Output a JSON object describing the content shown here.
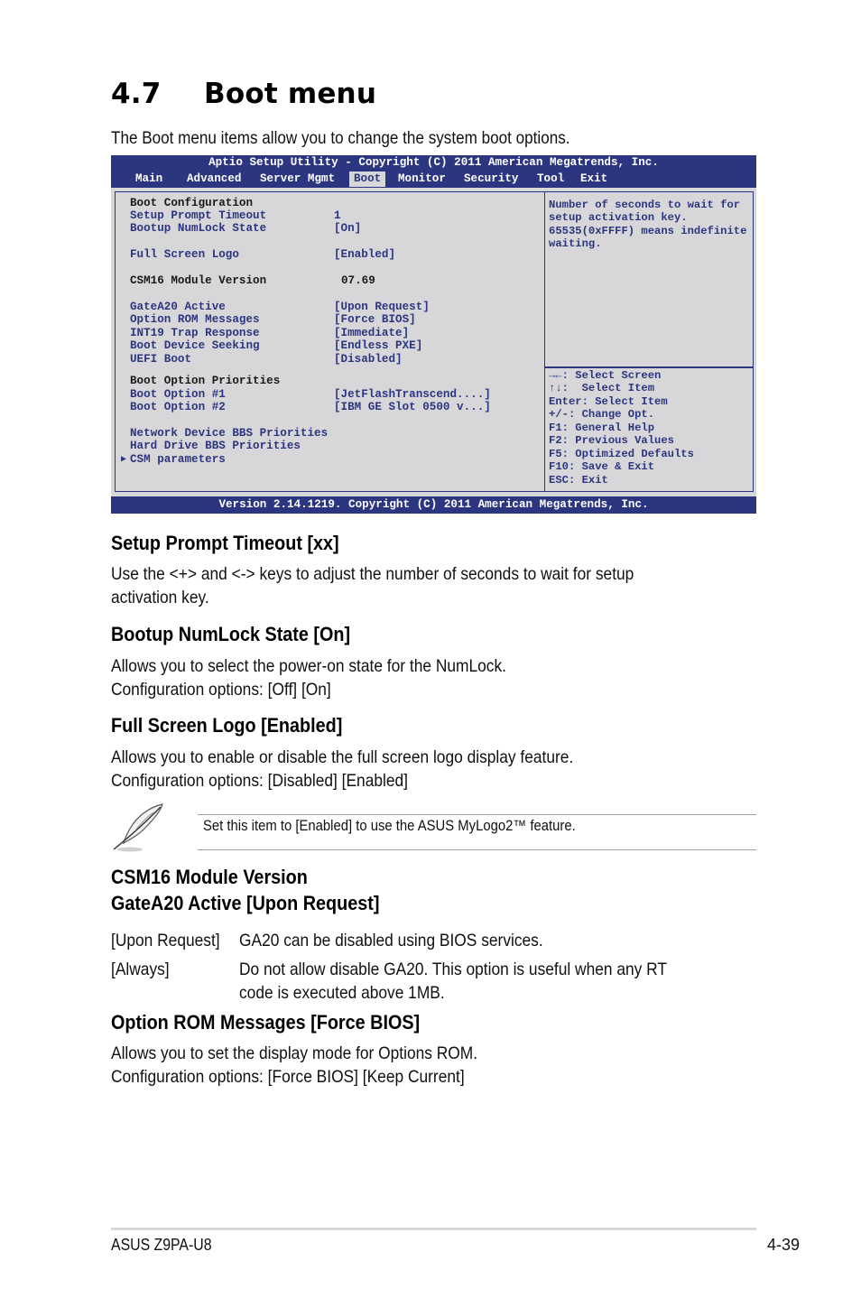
{
  "section": {
    "number": "4.7",
    "title": "Boot menu",
    "intro": "The Boot menu items allow you to change the system boot options."
  },
  "bios": {
    "title": "Aptio Setup Utility - Copyright (C) 2011 American Megatrends, Inc.",
    "tabs": [
      "Main",
      "Advanced",
      "Server Mgmt",
      "Boot",
      "Monitor",
      "Security",
      "Tool",
      "Exit"
    ],
    "active_tab": "Boot",
    "rows": {
      "boot_config_header": "Boot Configuration",
      "setup_prompt_timeout": {
        "label": "Setup Prompt Timeout",
        "value": "1"
      },
      "bootup_numlock": {
        "label": "Bootup NumLock State",
        "value": "[On]"
      },
      "full_screen_logo": {
        "label": "Full Screen Logo",
        "value": "[Enabled]"
      },
      "csm16_version": {
        "label": "CSM16 Module Version",
        "value": "07.69"
      },
      "gatea20": {
        "label": "GateA20 Active",
        "value": "[Upon Request]"
      },
      "option_rom": {
        "label": "Option ROM Messages",
        "value": "[Force BIOS]"
      },
      "int19": {
        "label": "INT19 Trap Response",
        "value": "[Immediate]"
      },
      "boot_device_seeking": {
        "label": "Boot Device Seeking",
        "value": "[Endless PXE]"
      },
      "uefi_boot": {
        "label": "UEFI Boot",
        "value": "[Disabled]"
      },
      "boot_priorities_header": "Boot Option Priorities",
      "boot_option_1": {
        "label": "Boot Option #1",
        "value": "[JetFlashTranscend....]"
      },
      "boot_option_2": {
        "label": "Boot Option #2",
        "value": "[IBM GE Slot 0500 v...]"
      },
      "network_bbs": "Network Device BBS Priorities",
      "hdd_bbs": "Hard Drive BBS Priorities",
      "csm_parameters": "CSM parameters"
    },
    "help_text": [
      "Number of seconds to wait for",
      "setup activation key.",
      "65535(0xFFFF) means indefinite",
      "waiting."
    ],
    "key_help": [
      "→←: Select Screen",
      "↑↓:  Select Item",
      "Enter: Select Item",
      "+/-: Change Opt.",
      "F1: General Help",
      "F2: Previous Values",
      "F5: Optimized Defaults",
      "F10: Save & Exit",
      "ESC: Exit"
    ],
    "footer": "Version 2.14.1219. Copyright (C) 2011 American Megatrends, Inc."
  },
  "docs": {
    "setup_prompt": {
      "heading": "Setup Prompt Timeout [xx]",
      "lines": [
        "Use the <+> and <-> keys to adjust the number of seconds to wait for setup",
        "activation key."
      ]
    },
    "numlock": {
      "heading": "Bootup NumLock State [On]",
      "lines": [
        "Allows you to select the power-on state for the NumLock.",
        "Configuration options: [Off] [On]"
      ]
    },
    "logo": {
      "heading": "Full Screen Logo [Enabled]",
      "lines": [
        "Allows you to enable or disable the full screen logo display feature.",
        "Configuration options: [Disabled] [Enabled]"
      ]
    },
    "note": "Set this item to [Enabled] to use the ASUS MyLogo2™ feature.",
    "csm": {
      "heading1": "CSM16 Module Version",
      "heading2": "GateA20 Active [Upon Request]",
      "options": [
        {
          "key": "[Upon Request]",
          "desc": [
            "GA20 can be disabled using BIOS services."
          ]
        },
        {
          "key": "[Always]",
          "desc": [
            "Do not allow disable GA20. This option is useful when any RT",
            "code is executed above 1MB."
          ]
        }
      ]
    },
    "option_rom": {
      "heading": "Option ROM Messages [Force BIOS]",
      "lines": [
        "Allows you to set the display mode for Options ROM.",
        "Configuration options: [Force BIOS] [Keep Current]"
      ]
    }
  },
  "footer": {
    "product": "ASUS Z9PA-U8",
    "page": "4-39"
  }
}
